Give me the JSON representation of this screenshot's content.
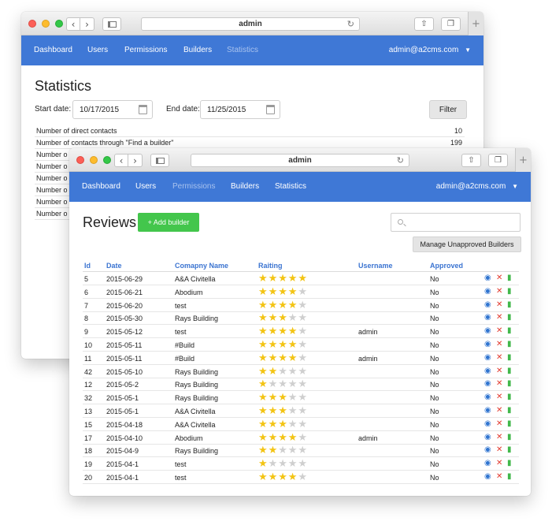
{
  "colors": {
    "navbar": "#3f78d6",
    "accent_link": "#3b74d1",
    "add_button": "#43c64c",
    "star_on": "#f3c414",
    "star_off": "#cfcfcf",
    "delete": "#e23a2f",
    "approve": "#42b84b"
  },
  "back_window": {
    "url": "admin",
    "nav": {
      "items": [
        "Dashboard",
        "Users",
        "Permissions",
        "Builders",
        "Statistics"
      ],
      "active": "Statistics",
      "user": "admin@a2cms.com"
    },
    "page_title": "Statistics",
    "start_label": "Start date:",
    "start_value": "10/17/2015",
    "end_label": "End date:",
    "end_value": "11/25/2015",
    "filter_label": "Filter",
    "stats": [
      {
        "label": "Number of direct contacts",
        "value": "10"
      },
      {
        "label": "Number of contacts through \"Find a builder\"",
        "value": "199"
      },
      {
        "label": "Number o",
        "value": ""
      },
      {
        "label": "Number o",
        "value": ""
      },
      {
        "label": "Number o",
        "value": ""
      },
      {
        "label": "Number o",
        "value": ""
      },
      {
        "label": "Number o",
        "value": ""
      },
      {
        "label": "Number o",
        "value": ""
      }
    ]
  },
  "front_window": {
    "url": "admin",
    "nav": {
      "items": [
        "Dashboard",
        "Users",
        "Permissions",
        "Builders",
        "Statistics"
      ],
      "active": "Permissions",
      "user": "admin@a2cms.com"
    },
    "page_title": "Reviews",
    "add_button": "+ Add builder",
    "search_placeholder": "",
    "manage_button": "Manage Unapproved Builders",
    "columns": [
      "Id",
      "Date",
      "Comapny Name",
      "Raiting",
      "Username",
      "Approved"
    ],
    "rows": [
      {
        "id": "5",
        "date": "2015-06-29",
        "company": "A&A Civitella",
        "rating": 5,
        "username": "",
        "approved": "No"
      },
      {
        "id": "6",
        "date": "2015-06-21",
        "company": "Abodium",
        "rating": 4,
        "username": "",
        "approved": "No"
      },
      {
        "id": "7",
        "date": "2015-06-20",
        "company": "test",
        "rating": 4,
        "username": "",
        "approved": "No"
      },
      {
        "id": "8",
        "date": "2015-05-30",
        "company": "Rays Building",
        "rating": 3,
        "username": "",
        "approved": "No"
      },
      {
        "id": "9",
        "date": "2015-05-12",
        "company": "test",
        "rating": 4,
        "username": "admin",
        "approved": "No"
      },
      {
        "id": "10",
        "date": "2015-05-11",
        "company": "#Build",
        "rating": 4,
        "username": "",
        "approved": "No"
      },
      {
        "id": "11",
        "date": "2015-05-11",
        "company": "#Build",
        "rating": 4,
        "username": "admin",
        "approved": "No"
      },
      {
        "id": "42",
        "date": "2015-05-10",
        "company": "Rays Building",
        "rating": 2,
        "username": "",
        "approved": "No"
      },
      {
        "id": "12",
        "date": "2015-05-2",
        "company": "Rays Building",
        "rating": 1,
        "username": "",
        "approved": "No"
      },
      {
        "id": "32",
        "date": "2015-05-1",
        "company": "Rays Building",
        "rating": 3,
        "username": "",
        "approved": "No"
      },
      {
        "id": "13",
        "date": "2015-05-1",
        "company": "A&A Civitella",
        "rating": 3,
        "username": "",
        "approved": "No"
      },
      {
        "id": "15",
        "date": "2015-04-18",
        "company": "A&A Civitella",
        "rating": 3,
        "username": "",
        "approved": "No"
      },
      {
        "id": "17",
        "date": "2015-04-10",
        "company": "Abodium",
        "rating": 4,
        "username": "admin",
        "approved": "No"
      },
      {
        "id": "18",
        "date": "2015-04-9",
        "company": "Rays Building",
        "rating": 2,
        "username": "",
        "approved": "No"
      },
      {
        "id": "19",
        "date": "2015-04-1",
        "company": "test",
        "rating": 1,
        "username": "",
        "approved": "No"
      },
      {
        "id": "20",
        "date": "2015-04-1",
        "company": "test",
        "rating": 4,
        "username": "",
        "approved": "No"
      }
    ],
    "row_actions": [
      "eye-icon",
      "close-icon",
      "thumbs-up-icon"
    ]
  }
}
